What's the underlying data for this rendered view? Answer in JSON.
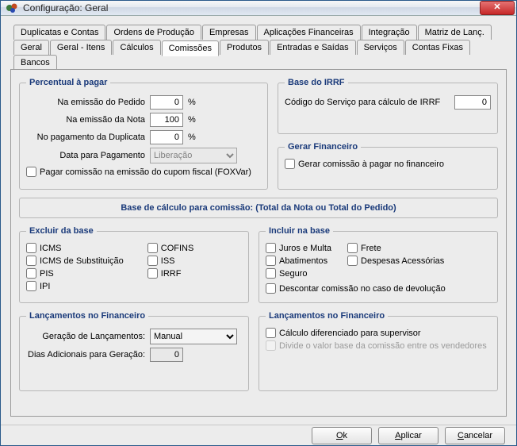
{
  "window": {
    "title": "Configuração: Geral"
  },
  "tabs_row1": [
    "Duplicatas e Contas",
    "Ordens de Produção",
    "Empresas",
    "Aplicações Financeiras",
    "Integração",
    "Matriz de Lanç."
  ],
  "tabs_row2": [
    "Geral",
    "Geral - Itens",
    "Cálculos",
    "Comissões",
    "Produtos",
    "Entradas e Saídas",
    "Serviços",
    "Contas Fixas",
    "Bancos"
  ],
  "active_tab": "Comissões",
  "percentual": {
    "legend": "Percentual à pagar",
    "emissao_pedido_label": "Na emissão do Pedido",
    "emissao_pedido_value": "0",
    "emissao_nota_label": "Na emissão da Nota",
    "emissao_nota_value": "100",
    "pagto_duplicata_label": "No pagamento da Duplicata",
    "pagto_duplicata_value": "0",
    "percent_suffix": "%",
    "data_pagamento_label": "Data para Pagamento",
    "data_pagamento_value": "Liberação",
    "cupom_label": "Pagar comissão na emissão do cupom fiscal (FOXVar)"
  },
  "irrf": {
    "legend": "Base do IRRF",
    "codigo_label": "Código do Serviço para cálculo de IRRF",
    "codigo_value": "0"
  },
  "gerar_fin": {
    "legend": "Gerar Financeiro",
    "opt_label": "Gerar comissão à pagar no financeiro"
  },
  "banner": "Base de cálculo para comissão: (Total da Nota ou Total do Pedido)",
  "excluir": {
    "legend": "Excluir da base",
    "col1": [
      "ICMS",
      "ICMS de Substituição",
      "PIS",
      "IPI"
    ],
    "col2": [
      "COFINS",
      "ISS",
      "IRRF"
    ]
  },
  "incluir": {
    "legend": "Incluir na base",
    "col1": [
      "Juros e Multa",
      "Abatimentos",
      "Seguro"
    ],
    "col2": [
      "Frete",
      "Despesas Acessórias"
    ],
    "descontar": "Descontar comissão no caso de devolução"
  },
  "lanc_left": {
    "legend": "Lançamentos no Financeiro",
    "geracao_label": "Geração de Lançamentos:",
    "geracao_value": "Manual",
    "dias_label": "Dias Adicionais para Geração:",
    "dias_value": "0"
  },
  "lanc_right": {
    "legend": "Lançamentos no Financeiro",
    "calc_label": "Cálculo diferenciado para supervisor",
    "divide_label": "Divide o valor base da comissão entre os vendedores"
  },
  "buttons": {
    "ok": "Ok",
    "aplicar": "Aplicar",
    "cancelar": "Cancelar"
  }
}
